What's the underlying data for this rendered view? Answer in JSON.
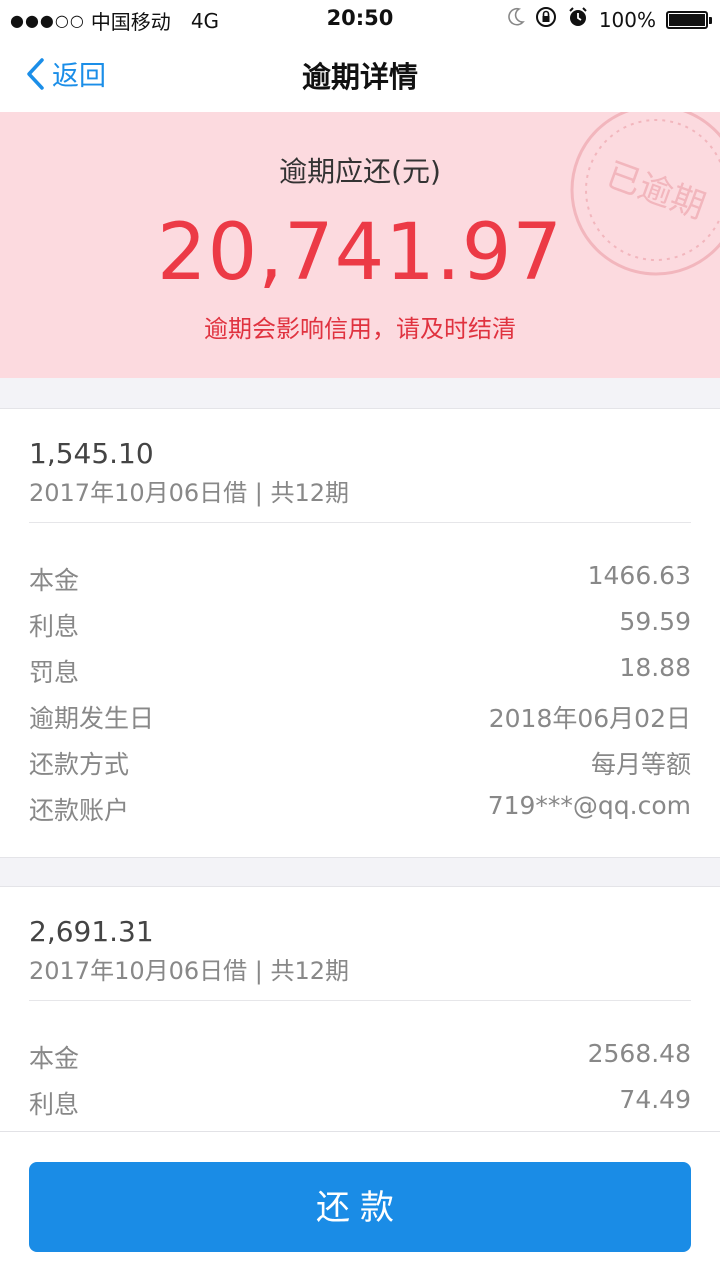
{
  "status_bar": {
    "signal": "●●●○○",
    "carrier": "中国移动",
    "network": "4G",
    "time": "20:50",
    "battery_text": "100%",
    "battery_level": 1.0,
    "icons": [
      "moon-icon",
      "rotation-lock-icon",
      "alarm-icon",
      "battery-icon"
    ]
  },
  "nav": {
    "back_label": "返回",
    "title": "逾期详情"
  },
  "banner": {
    "label": "逾期应还(元)",
    "amount": "20,741.97",
    "note": "逾期会影响信用，请及时结清",
    "stamp_text": "已逾期",
    "background": "#fcdadf",
    "accent": "#ec3a46"
  },
  "loans": [
    {
      "amount": "1,545.10",
      "subtitle": "2017年10月06日借 | 共12期",
      "rows": [
        {
          "key": "本金",
          "value": "1466.63"
        },
        {
          "key": "利息",
          "value": "59.59"
        },
        {
          "key": "罚息",
          "value": "18.88"
        },
        {
          "key": "逾期发生日",
          "value": "2018年06月02日"
        },
        {
          "key": "还款方式",
          "value": "每月等额"
        },
        {
          "key": "还款账户",
          "value": "719***@qq.com"
        }
      ]
    },
    {
      "amount": "2,691.31",
      "subtitle": "2017年10月06日借 | 共12期",
      "rows": [
        {
          "key": "本金",
          "value": "2568.48"
        },
        {
          "key": "利息",
          "value": "74.49"
        }
      ]
    }
  ],
  "footer": {
    "pay_button": "还款",
    "button_color": "#1a8ce6"
  }
}
